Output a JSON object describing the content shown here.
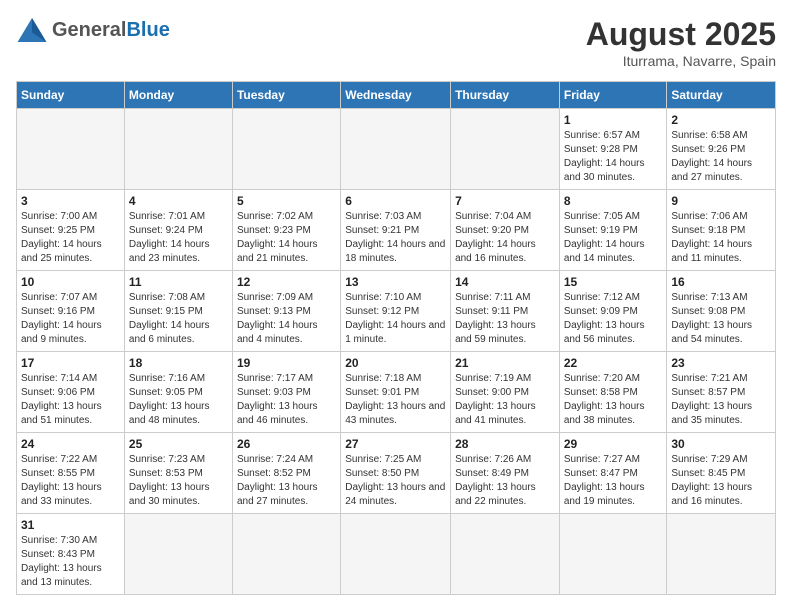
{
  "header": {
    "logo_general": "General",
    "logo_blue": "Blue",
    "month_title": "August 2025",
    "location": "Iturrama, Navarre, Spain"
  },
  "weekdays": [
    "Sunday",
    "Monday",
    "Tuesday",
    "Wednesday",
    "Thursday",
    "Friday",
    "Saturday"
  ],
  "weeks": [
    [
      {
        "day": "",
        "info": ""
      },
      {
        "day": "",
        "info": ""
      },
      {
        "day": "",
        "info": ""
      },
      {
        "day": "",
        "info": ""
      },
      {
        "day": "",
        "info": ""
      },
      {
        "day": "1",
        "info": "Sunrise: 6:57 AM\nSunset: 9:28 PM\nDaylight: 14 hours and 30 minutes."
      },
      {
        "day": "2",
        "info": "Sunrise: 6:58 AM\nSunset: 9:26 PM\nDaylight: 14 hours and 27 minutes."
      }
    ],
    [
      {
        "day": "3",
        "info": "Sunrise: 7:00 AM\nSunset: 9:25 PM\nDaylight: 14 hours and 25 minutes."
      },
      {
        "day": "4",
        "info": "Sunrise: 7:01 AM\nSunset: 9:24 PM\nDaylight: 14 hours and 23 minutes."
      },
      {
        "day": "5",
        "info": "Sunrise: 7:02 AM\nSunset: 9:23 PM\nDaylight: 14 hours and 21 minutes."
      },
      {
        "day": "6",
        "info": "Sunrise: 7:03 AM\nSunset: 9:21 PM\nDaylight: 14 hours and 18 minutes."
      },
      {
        "day": "7",
        "info": "Sunrise: 7:04 AM\nSunset: 9:20 PM\nDaylight: 14 hours and 16 minutes."
      },
      {
        "day": "8",
        "info": "Sunrise: 7:05 AM\nSunset: 9:19 PM\nDaylight: 14 hours and 14 minutes."
      },
      {
        "day": "9",
        "info": "Sunrise: 7:06 AM\nSunset: 9:18 PM\nDaylight: 14 hours and 11 minutes."
      }
    ],
    [
      {
        "day": "10",
        "info": "Sunrise: 7:07 AM\nSunset: 9:16 PM\nDaylight: 14 hours and 9 minutes."
      },
      {
        "day": "11",
        "info": "Sunrise: 7:08 AM\nSunset: 9:15 PM\nDaylight: 14 hours and 6 minutes."
      },
      {
        "day": "12",
        "info": "Sunrise: 7:09 AM\nSunset: 9:13 PM\nDaylight: 14 hours and 4 minutes."
      },
      {
        "day": "13",
        "info": "Sunrise: 7:10 AM\nSunset: 9:12 PM\nDaylight: 14 hours and 1 minute."
      },
      {
        "day": "14",
        "info": "Sunrise: 7:11 AM\nSunset: 9:11 PM\nDaylight: 13 hours and 59 minutes."
      },
      {
        "day": "15",
        "info": "Sunrise: 7:12 AM\nSunset: 9:09 PM\nDaylight: 13 hours and 56 minutes."
      },
      {
        "day": "16",
        "info": "Sunrise: 7:13 AM\nSunset: 9:08 PM\nDaylight: 13 hours and 54 minutes."
      }
    ],
    [
      {
        "day": "17",
        "info": "Sunrise: 7:14 AM\nSunset: 9:06 PM\nDaylight: 13 hours and 51 minutes."
      },
      {
        "day": "18",
        "info": "Sunrise: 7:16 AM\nSunset: 9:05 PM\nDaylight: 13 hours and 48 minutes."
      },
      {
        "day": "19",
        "info": "Sunrise: 7:17 AM\nSunset: 9:03 PM\nDaylight: 13 hours and 46 minutes."
      },
      {
        "day": "20",
        "info": "Sunrise: 7:18 AM\nSunset: 9:01 PM\nDaylight: 13 hours and 43 minutes."
      },
      {
        "day": "21",
        "info": "Sunrise: 7:19 AM\nSunset: 9:00 PM\nDaylight: 13 hours and 41 minutes."
      },
      {
        "day": "22",
        "info": "Sunrise: 7:20 AM\nSunset: 8:58 PM\nDaylight: 13 hours and 38 minutes."
      },
      {
        "day": "23",
        "info": "Sunrise: 7:21 AM\nSunset: 8:57 PM\nDaylight: 13 hours and 35 minutes."
      }
    ],
    [
      {
        "day": "24",
        "info": "Sunrise: 7:22 AM\nSunset: 8:55 PM\nDaylight: 13 hours and 33 minutes."
      },
      {
        "day": "25",
        "info": "Sunrise: 7:23 AM\nSunset: 8:53 PM\nDaylight: 13 hours and 30 minutes."
      },
      {
        "day": "26",
        "info": "Sunrise: 7:24 AM\nSunset: 8:52 PM\nDaylight: 13 hours and 27 minutes."
      },
      {
        "day": "27",
        "info": "Sunrise: 7:25 AM\nSunset: 8:50 PM\nDaylight: 13 hours and 24 minutes."
      },
      {
        "day": "28",
        "info": "Sunrise: 7:26 AM\nSunset: 8:49 PM\nDaylight: 13 hours and 22 minutes."
      },
      {
        "day": "29",
        "info": "Sunrise: 7:27 AM\nSunset: 8:47 PM\nDaylight: 13 hours and 19 minutes."
      },
      {
        "day": "30",
        "info": "Sunrise: 7:29 AM\nSunset: 8:45 PM\nDaylight: 13 hours and 16 minutes."
      }
    ],
    [
      {
        "day": "31",
        "info": "Sunrise: 7:30 AM\nSunset: 8:43 PM\nDaylight: 13 hours and 13 minutes."
      },
      {
        "day": "",
        "info": ""
      },
      {
        "day": "",
        "info": ""
      },
      {
        "day": "",
        "info": ""
      },
      {
        "day": "",
        "info": ""
      },
      {
        "day": "",
        "info": ""
      },
      {
        "day": "",
        "info": ""
      }
    ]
  ]
}
